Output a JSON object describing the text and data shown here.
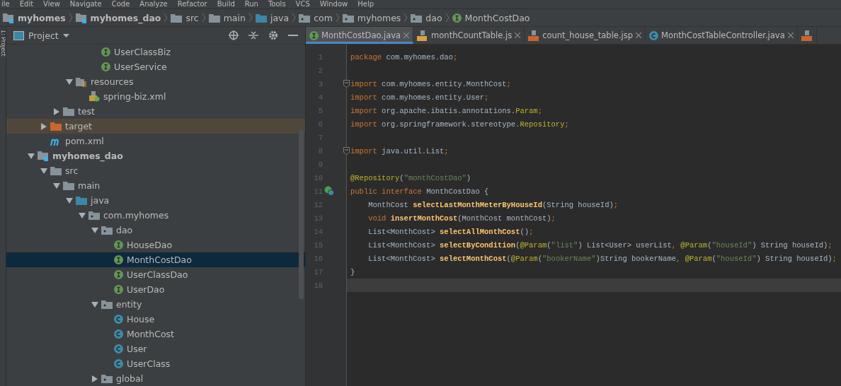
{
  "menu": [
    "ile",
    "Edit",
    "View",
    "Navigate",
    "Code",
    "Analyze",
    "Refactor",
    "Build",
    "Run",
    "Tools",
    "VCS",
    "Window",
    "Help"
  ],
  "breadcrumbs": [
    {
      "label": "myhomes",
      "kind": "module"
    },
    {
      "label": "myhomes_dao",
      "kind": "module"
    },
    {
      "label": "src",
      "kind": "folder"
    },
    {
      "label": "main",
      "kind": "folder"
    },
    {
      "label": "java",
      "kind": "source"
    },
    {
      "label": "com",
      "kind": "package"
    },
    {
      "label": "myhomes",
      "kind": "package"
    },
    {
      "label": "dao",
      "kind": "package"
    },
    {
      "label": "MonthCostDao",
      "kind": "interface"
    }
  ],
  "tool_strip": {
    "label": "1: Project"
  },
  "project_panel": {
    "title": "Project",
    "items": [
      {
        "children": [
          {
            "children": [
              {
                "children": [
                  {
                    "children": [
                      {
                        "children": [
                          {
                            "label": "UserClassBiz",
                            "kind": "interface",
                            "selected": false
                          },
                          {
                            "label": "UserService",
                            "kind": "interface",
                            "selected": false
                          }
                        ]
                      }
                    ]
                  },
                  {
                    "label": "resources",
                    "kind": "resources",
                    "expanded": true,
                    "selected": false,
                    "children": [
                      {
                        "label": "spring-biz.xml",
                        "kind": "xml",
                        "selected": false
                      }
                    ]
                  }
                ]
              },
              {
                "label": "test",
                "kind": "folder",
                "expanded": false,
                "selected": false
              }
            ]
          },
          {
            "label": "target",
            "kind": "excluded",
            "expanded": false,
            "selected": false,
            "highlighted": true
          },
          {
            "label": "pom.xml",
            "kind": "maven",
            "selected": false
          }
        ]
      },
      {
        "label": "myhomes_dao",
        "kind": "module",
        "expanded": true,
        "selected": false,
        "children": [
          {
            "label": "src",
            "kind": "folder",
            "expanded": true,
            "selected": false,
            "children": [
              {
                "label": "main",
                "kind": "folder",
                "expanded": true,
                "selected": false,
                "children": [
                  {
                    "label": "java",
                    "kind": "source",
                    "expanded": true,
                    "selected": false,
                    "children": [
                      {
                        "label": "com.myhomes",
                        "kind": "package",
                        "expanded": true,
                        "selected": false,
                        "children": [
                          {
                            "label": "dao",
                            "kind": "package",
                            "expanded": true,
                            "selected": false,
                            "children": [
                              {
                                "label": "HouseDao",
                                "kind": "interface",
                                "selected": false
                              },
                              {
                                "label": "MonthCostDao",
                                "kind": "interface",
                                "selected": true
                              },
                              {
                                "label": "UserClassDao",
                                "kind": "interface",
                                "selected": false
                              },
                              {
                                "label": "UserDao",
                                "kind": "interface",
                                "selected": false
                              }
                            ]
                          },
                          {
                            "label": "entity",
                            "kind": "package",
                            "expanded": true,
                            "selected": false,
                            "children": [
                              {
                                "label": "House",
                                "kind": "class",
                                "selected": false
                              },
                              {
                                "label": "MonthCost",
                                "kind": "class",
                                "selected": false
                              },
                              {
                                "label": "User",
                                "kind": "class",
                                "selected": false
                              },
                              {
                                "label": "UserClass",
                                "kind": "class",
                                "selected": false
                              }
                            ]
                          },
                          {
                            "label": "global",
                            "kind": "package",
                            "expanded": false,
                            "selected": false
                          }
                        ]
                      }
                    ]
                  }
                ]
              }
            ]
          }
        ]
      }
    ]
  },
  "tabs": [
    {
      "label": "MonthCostDao.java",
      "kind": "interface",
      "selected": true
    },
    {
      "label": "monthCountTable.js",
      "kind": "js",
      "selected": false
    },
    {
      "label": "count_house_table.jsp",
      "kind": "jsp",
      "selected": false
    },
    {
      "label": "MonthCostTableController.java",
      "kind": "class",
      "selected": false
    }
  ],
  "editor": {
    "lines": [
      {
        "number": "1",
        "tokens": [
          {
            "kind": "keyword",
            "text": "package "
          },
          {
            "kind": "plain",
            "text": "com.myhomes.dao"
          },
          {
            "kind": "keyword",
            "text": ";"
          }
        ]
      },
      {
        "number": "2"
      },
      {
        "number": "3",
        "fold": true,
        "tokens": [
          {
            "kind": "keyword",
            "text": "import "
          },
          {
            "kind": "plain",
            "text": "com.myhomes.entity.MonthCost"
          },
          {
            "kind": "keyword",
            "text": ";"
          }
        ]
      },
      {
        "number": "4",
        "tokens": [
          {
            "kind": "keyword",
            "text": "import "
          },
          {
            "kind": "plain",
            "text": "com.myhomes.entity.User"
          },
          {
            "kind": "keyword",
            "text": ";"
          }
        ]
      },
      {
        "number": "5",
        "tokens": [
          {
            "kind": "keyword",
            "text": "import "
          },
          {
            "kind": "plain",
            "text": "org.apache.ibatis.annotations."
          },
          {
            "kind": "annotation",
            "text": "Param"
          },
          {
            "kind": "keyword",
            "text": ";"
          }
        ]
      },
      {
        "number": "6",
        "tokens": [
          {
            "kind": "keyword",
            "text": "import "
          },
          {
            "kind": "plain",
            "text": "org.springframework.stereotype."
          },
          {
            "kind": "annotation",
            "text": "Repository"
          },
          {
            "kind": "keyword",
            "text": ";"
          }
        ]
      },
      {
        "number": "7"
      },
      {
        "number": "8",
        "fold": true,
        "tokens": [
          {
            "kind": "keyword",
            "text": "import "
          },
          {
            "kind": "plain",
            "text": "java.util.List"
          },
          {
            "kind": "keyword",
            "text": ";"
          }
        ]
      },
      {
        "number": "9"
      },
      {
        "number": "10",
        "tokens": [
          {
            "kind": "annotation",
            "text": "@Repository"
          },
          {
            "kind": "plain",
            "text": "("
          },
          {
            "kind": "string",
            "text": "\"monthCostDao\""
          },
          {
            "kind": "plain",
            "text": ")"
          }
        ]
      },
      {
        "number": "11",
        "implemented": true,
        "tokens": [
          {
            "kind": "keyword",
            "text": "public interface "
          },
          {
            "kind": "plain",
            "text": "MonthCostDao {"
          }
        ]
      },
      {
        "number": "12",
        "tokens": [
          {
            "kind": "plain",
            "text": "    MonthCost "
          },
          {
            "kind": "method",
            "text": "selectLastMonthMeterByHouseId"
          },
          {
            "kind": "plain",
            "text": "(String houseId)"
          },
          {
            "kind": "keyword",
            "text": ";"
          }
        ]
      },
      {
        "number": "13",
        "tokens": [
          {
            "kind": "keyword",
            "text": "    void "
          },
          {
            "kind": "method",
            "text": "insertMonthCost"
          },
          {
            "kind": "plain",
            "text": "(MonthCost monthCost)"
          },
          {
            "kind": "keyword",
            "text": ";"
          }
        ]
      },
      {
        "number": "14",
        "tokens": [
          {
            "kind": "plain",
            "text": "    List<MonthCost> "
          },
          {
            "kind": "method",
            "text": "selectAllMonthCost"
          },
          {
            "kind": "plain",
            "text": "()"
          },
          {
            "kind": "keyword",
            "text": ";"
          }
        ]
      },
      {
        "number": "15",
        "tokens": [
          {
            "kind": "plain",
            "text": "    List<MonthCost> "
          },
          {
            "kind": "method",
            "text": "selectByCondition"
          },
          {
            "kind": "plain",
            "text": "("
          },
          {
            "kind": "annotation",
            "text": "@Param"
          },
          {
            "kind": "plain",
            "text": "("
          },
          {
            "kind": "string",
            "text": "\"list\""
          },
          {
            "kind": "plain",
            "text": ") List<User> userList"
          },
          {
            "kind": "keyword",
            "text": ", "
          },
          {
            "kind": "annotation",
            "text": "@Param"
          },
          {
            "kind": "plain",
            "text": "("
          },
          {
            "kind": "string",
            "text": "\"houseId\""
          },
          {
            "kind": "plain",
            "text": ") String houseId)"
          },
          {
            "kind": "keyword",
            "text": ";"
          }
        ]
      },
      {
        "number": "16",
        "tokens": [
          {
            "kind": "plain",
            "text": "    List<MonthCost> "
          },
          {
            "kind": "method",
            "text": "selectMonthCost"
          },
          {
            "kind": "plain",
            "text": "("
          },
          {
            "kind": "annotation",
            "text": "@Param"
          },
          {
            "kind": "plain",
            "text": "("
          },
          {
            "kind": "string",
            "text": "\"bookerName\""
          },
          {
            "kind": "plain",
            "text": ")String bookerName"
          },
          {
            "kind": "keyword",
            "text": ", "
          },
          {
            "kind": "annotation",
            "text": "@Param"
          },
          {
            "kind": "plain",
            "text": "("
          },
          {
            "kind": "string",
            "text": "\"houseId\""
          },
          {
            "kind": "plain",
            "text": ") String houseId)"
          },
          {
            "kind": "keyword",
            "text": ";"
          }
        ]
      },
      {
        "number": "17",
        "tokens": [
          {
            "kind": "plain",
            "text": "}"
          }
        ]
      },
      {
        "number": "18",
        "current": true
      }
    ]
  }
}
